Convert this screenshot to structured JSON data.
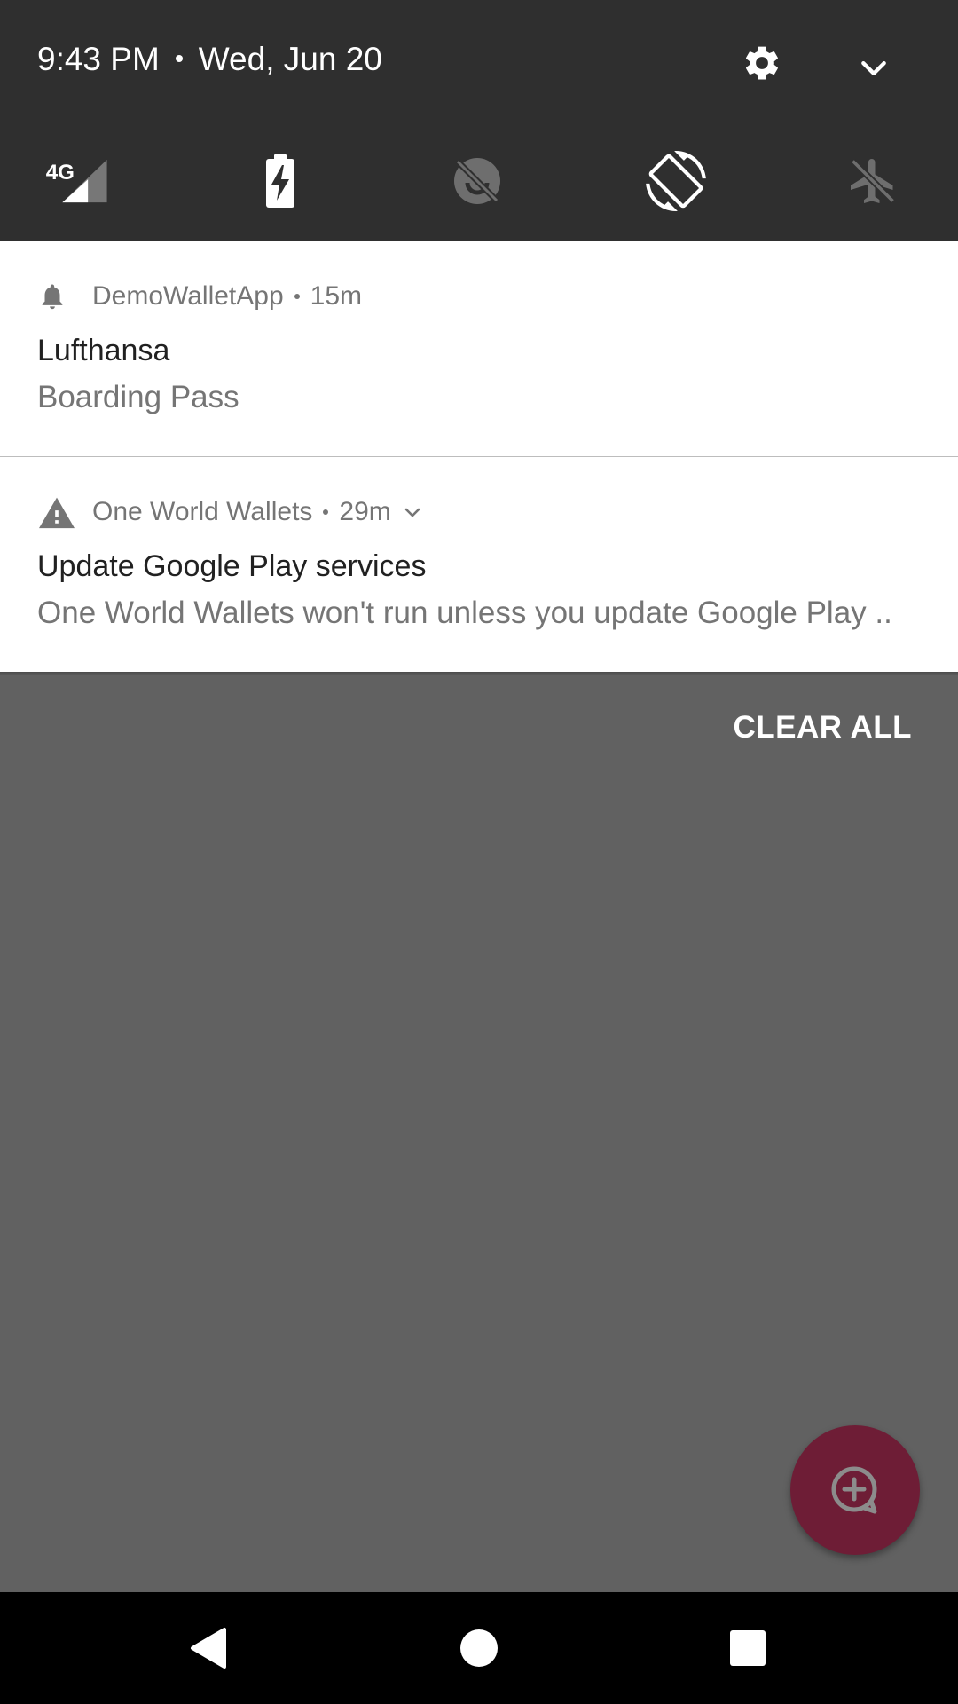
{
  "status": {
    "time": "9:43 PM",
    "date": "Wed, Jun 20"
  },
  "quick_settings": {
    "settings_icon": "gear-icon",
    "expand_icon": "chevron-down-icon",
    "tiles": [
      {
        "name": "mobile-data",
        "icon": "signal-4g-icon",
        "label": "4G",
        "state": "on"
      },
      {
        "name": "battery-saver",
        "icon": "battery-charging-icon",
        "state": "on"
      },
      {
        "name": "data-saver",
        "icon": "data-saver-off-icon",
        "state": "off"
      },
      {
        "name": "auto-rotate",
        "icon": "screen-rotation-icon",
        "state": "on"
      },
      {
        "name": "airplane-mode",
        "icon": "airplane-icon",
        "state": "off"
      }
    ]
  },
  "notifications": [
    {
      "app_icon": "bell-icon",
      "app": "DemoWalletApp",
      "time": "15m",
      "title": "Lufthansa",
      "text": "Boarding Pass"
    },
    {
      "app_icon": "warning-icon",
      "app": "One World Wallets",
      "time": "29m",
      "title": "Update Google Play services",
      "text": "One World Wallets won't run unless you update Google Play .."
    }
  ],
  "clear_all_label": "CLEAR ALL",
  "fab": {
    "icon": "add-circle-icon",
    "color": "#6e1d36"
  },
  "nav_bar": {
    "back_icon": "back-triangle-icon",
    "home_icon": "home-circle-icon",
    "recents_icon": "recents-square-icon"
  },
  "colors": {
    "header_bg": "#2f2f2f",
    "scrim": "#616161",
    "card_bg": "#ffffff",
    "primary_text": "#212121",
    "secondary_text": "#757575"
  }
}
